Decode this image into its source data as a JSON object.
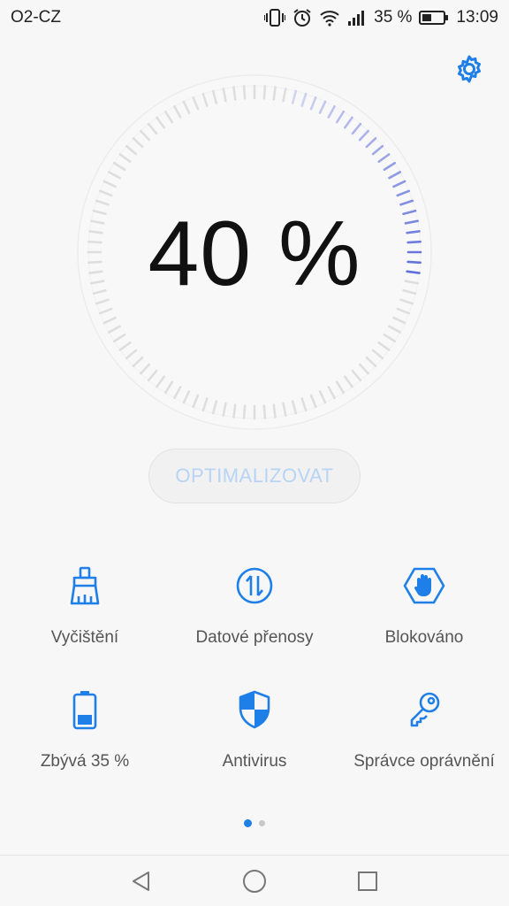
{
  "status_bar": {
    "carrier": "O2-CZ",
    "battery_text": "35 %",
    "time": "13:09",
    "icons": [
      "vibrate-icon",
      "alarm-icon",
      "wifi-icon",
      "signal-icon",
      "battery-icon"
    ]
  },
  "settings": {
    "icon": "gear-icon"
  },
  "gauge": {
    "value_text": "40 %",
    "level": 0.4
  },
  "optimize": {
    "label": "OPTIMALIZOVAT"
  },
  "tiles": [
    {
      "label": "Vyčištění",
      "icon": "broom-icon"
    },
    {
      "label": "Datové přenosy",
      "icon": "data-transfer-icon"
    },
    {
      "label": "Blokováno",
      "icon": "blocked-hand-icon"
    },
    {
      "label": "Zbývá 35 %",
      "icon": "battery-icon"
    },
    {
      "label": "Antivirus",
      "icon": "shield-icon"
    },
    {
      "label": "Správce oprávnění",
      "icon": "key-icon"
    }
  ],
  "pager": {
    "count": 2,
    "active": 0
  },
  "nav": {
    "icons": [
      "back-icon",
      "home-icon",
      "recents-icon"
    ]
  },
  "colors": {
    "accent": "#1e7fe8",
    "gauge_track": "#dedede",
    "gauge_active": "#5b6bd8",
    "optimize_text": "#b8d4f5"
  }
}
